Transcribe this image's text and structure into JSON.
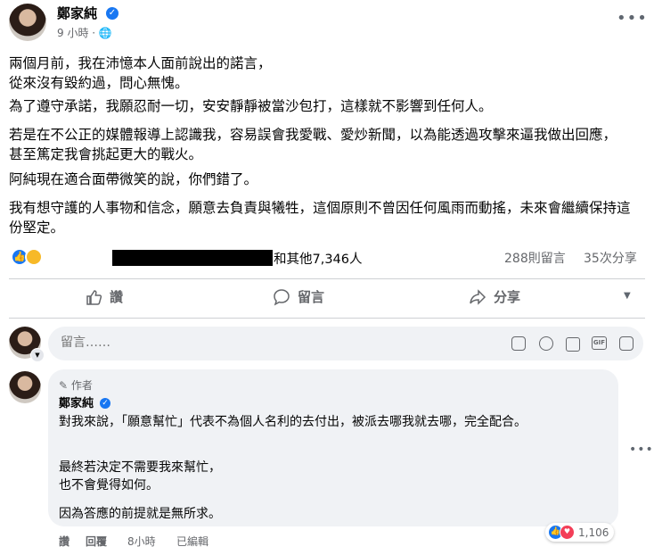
{
  "post": {
    "author": "鄭家純",
    "time": "9 小時",
    "paragraphs": [
      "兩個月前，我在沛憶本人面前說出的諾言，\n從來沒有毀約過，問心無愧。",
      "為了遵守承諾，我願忍耐一切，安安靜靜被當沙包打，這樣就不影響到任何人。",
      "若是在不公正的媒體報導上認識我，容易誤會我愛戰、愛炒新聞，以為能透過攻擊來逼我做出回應，甚至篤定我會挑起更大的戰火。",
      "阿純現在適合面帶微笑的說，你們錯了。",
      "我有想守護的人事物和信念，願意去負責與犧牲，這個原則不曾因任何風雨而動搖，未來會繼續保持這份堅定。"
    ],
    "reactions_text": "和其他7,346人",
    "comments_count": "288則留言",
    "shares_count": "35次分享"
  },
  "actions": {
    "like": "讚",
    "comment": "留言",
    "share": "分享"
  },
  "comment_box": {
    "placeholder": "留言……"
  },
  "comment": {
    "badge": "作者",
    "author": "鄭家純",
    "paragraphs": [
      "對我來說，「願意幫忙」代表不為個人名利的去付出，被派去哪我就去哪，完全配合。",
      "最終若決定不需要我來幫忙，\n也不會覺得如何。",
      "因為答應的前提就是無所求。"
    ],
    "like_label": "讚",
    "reply_label": "回覆",
    "time": "8小時",
    "edited": "已編輯",
    "reaction_count": "1,106"
  },
  "colors": {
    "accent": "#1877f2",
    "muted": "#65676b",
    "bubble": "#f0f2f5"
  }
}
